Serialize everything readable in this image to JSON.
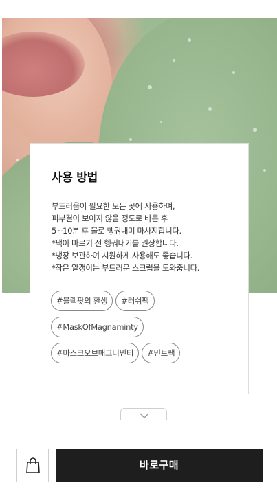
{
  "how_to": {
    "title": "사용 방법",
    "lines": [
      "부드러움이 필요한 모든 곳에 사용하며,",
      "피부결이 보이지 않을 정도로 바른 후",
      "5~10분 후 물로 헹궈내며 마사지합니다.",
      "*팩이 마르기 전 헹궈내기를 권장합니다.",
      "*냉장 보관하여 시원하게 사용해도 좋습니다.",
      "*작은 알갱이는 부드러운 스크럽을 도와줍니다."
    ]
  },
  "tags": [
    "#블랙팟의 환생",
    "#러쉬팩",
    "#MaskOfMagnaminty",
    "#마스크오브매그너민티",
    "#민트팩"
  ],
  "icons": {
    "expand": "chevron-down-icon",
    "bag": "shopping-bag-icon"
  },
  "bottom_bar": {
    "buy_label": "바로구매"
  },
  "colors": {
    "buy_button_bg": "#1e1e1e",
    "buy_button_text": "#ffffff"
  }
}
